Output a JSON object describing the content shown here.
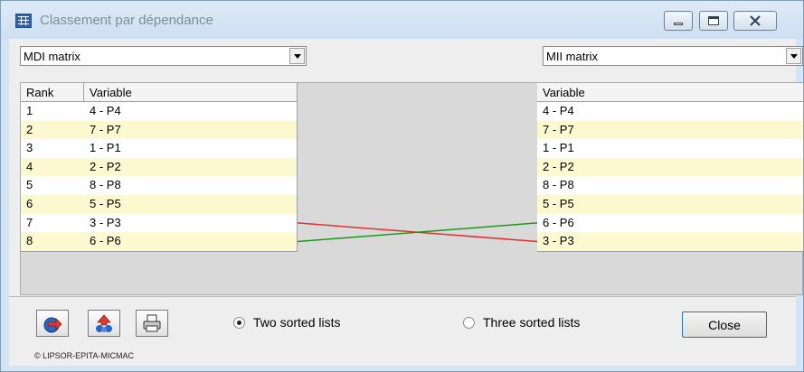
{
  "window": {
    "title": "Classement par dépendance"
  },
  "left_list": {
    "combo_value": "MDI matrix",
    "headers": {
      "rank": "Rank",
      "variable": "Variable"
    },
    "rows": [
      {
        "rank": "1",
        "variable": "4 - P4"
      },
      {
        "rank": "2",
        "variable": "7 - P7"
      },
      {
        "rank": "3",
        "variable": "1 - P1"
      },
      {
        "rank": "4",
        "variable": "2 - P2"
      },
      {
        "rank": "5",
        "variable": "8 - P8"
      },
      {
        "rank": "6",
        "variable": "5 - P5"
      },
      {
        "rank": "7",
        "variable": "3 - P3"
      },
      {
        "rank": "8",
        "variable": "6 - P6"
      }
    ]
  },
  "right_list": {
    "combo_value": "MII matrix",
    "headers": {
      "variable": "Variable"
    },
    "rows": [
      {
        "variable": "4 - P4"
      },
      {
        "variable": "7 - P7"
      },
      {
        "variable": "1 - P1"
      },
      {
        "variable": "2 - P2"
      },
      {
        "variable": "8 - P8"
      },
      {
        "variable": "5 - P5"
      },
      {
        "variable": "6 - P6"
      },
      {
        "variable": "3 - P3"
      }
    ]
  },
  "rank_links": [
    {
      "from_rank": 7,
      "to_rank": 8,
      "color": "#e03030"
    },
    {
      "from_rank": 8,
      "to_rank": 7,
      "color": "#1a9a1a"
    }
  ],
  "options": {
    "two_sorted": "Two sorted lists",
    "three_sorted": "Three sorted lists",
    "selected": "two_sorted"
  },
  "buttons": {
    "close": "Close",
    "tool_icons": [
      "export-icon",
      "sort-icon",
      "print-icon"
    ]
  },
  "footer": {
    "copyright": "© LIPSOR-EPITA-MICMAC"
  },
  "colors": {
    "row_highlight": "#fcf8cf",
    "link_up": "#e03030",
    "link_down": "#1a9a1a"
  }
}
